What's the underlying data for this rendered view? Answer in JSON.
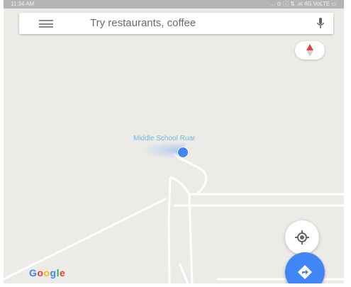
{
  "status_bar": {
    "time": "11:34 AM",
    "right": "... ⊙ ⓘ ⇅ .ııl 4G VoLTE ▭"
  },
  "search": {
    "placeholder": "Try restaurants, coffee"
  },
  "map": {
    "place_label": "Middle School Ruar"
  },
  "brand": {
    "logo_text": "Google",
    "logo_colors": [
      "#4285f4",
      "#ea4335",
      "#fbbc05",
      "#4285f4",
      "#34a853",
      "#ea4335"
    ]
  },
  "colors": {
    "accent": "#4285f4",
    "map_bg": "#ecebe8",
    "road": "#ffffff",
    "place_label": "#6fb7e0"
  },
  "icons": {
    "menu": "menu-icon",
    "mic": "mic-icon",
    "compass": "compass-icon",
    "my_location": "my-location-icon",
    "directions": "directions-icon"
  }
}
